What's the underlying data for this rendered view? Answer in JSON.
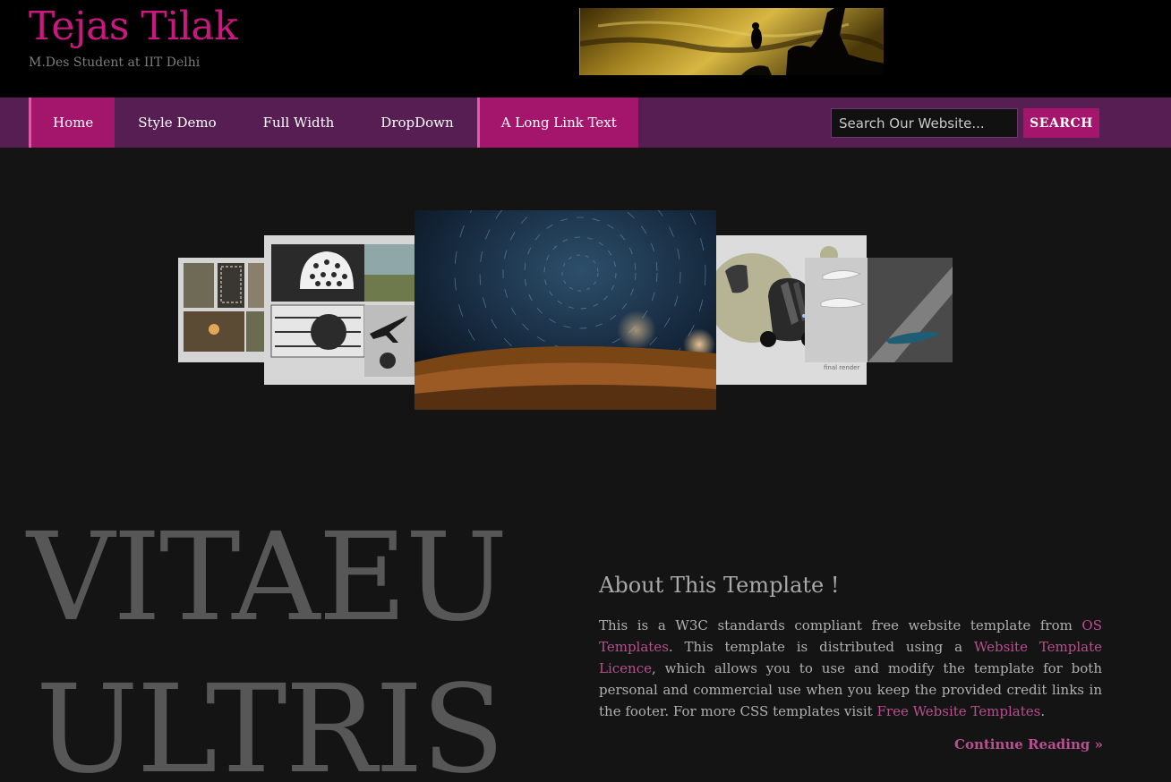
{
  "header": {
    "title": "Tejas Tilak",
    "tagline": "M.Des Student at IIT Delhi"
  },
  "nav": {
    "items": [
      {
        "label": "Home"
      },
      {
        "label": "Style Demo"
      },
      {
        "label": "Full Width"
      },
      {
        "label": "DropDown"
      },
      {
        "label": "A Long Link Text"
      }
    ],
    "search_placeholder": "Search Our Website...",
    "search_button": "SEARCH"
  },
  "hero": {
    "big_text_line1": "VITAEU",
    "big_text_line2": "ULTRIS"
  },
  "about": {
    "heading": "About This Template !",
    "p1": "This is a W3C standards compliant free website template from ",
    "link1": "OS Templates",
    "p2": ". This template is distributed using a ",
    "link2": "Website Template Licence",
    "p3": ", which allows you to use and modify the template for both personal and commercial use when you keep the provided credit links in the footer. For more CSS templates visit ",
    "link3": "Free Website Templates",
    "p4": ".",
    "continue": "Continue Reading »"
  },
  "slides": {
    "slide4_caption": "final render"
  },
  "colors": {
    "brand": "#c8197f",
    "nav_bg": "#561e52",
    "nav_active": "#a4156c",
    "page_bg": "#141414",
    "link": "#b7508f"
  }
}
